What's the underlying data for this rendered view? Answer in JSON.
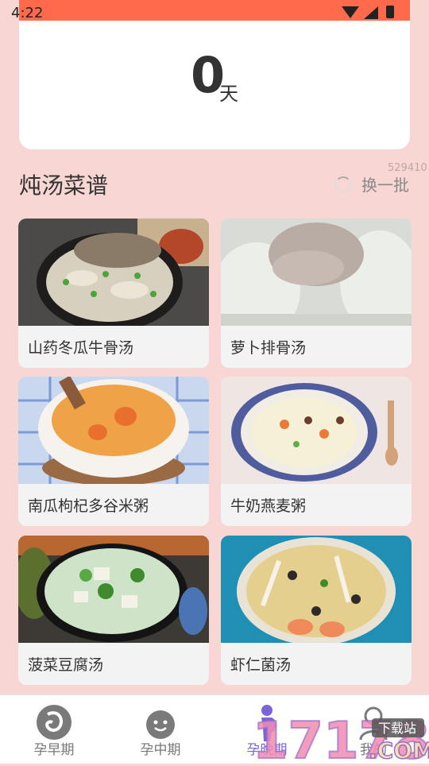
{
  "status_bar": {
    "time": "4:22"
  },
  "counter": {
    "value": "0",
    "unit": "天"
  },
  "section": {
    "title": "炖汤菜谱",
    "refresh_label": "换一批",
    "overlay_number": "529410"
  },
  "recipes": [
    {
      "name": "山药冬瓜牛骨汤"
    },
    {
      "name": "萝卜排骨汤"
    },
    {
      "name": "南瓜枸杞多谷米粥"
    },
    {
      "name": "牛奶燕麦粥"
    },
    {
      "name": "菠菜豆腐汤"
    },
    {
      "name": "虾仁菌汤"
    }
  ],
  "bottom_nav": {
    "items": [
      {
        "label": "孕早期",
        "icon": "fetus-icon"
      },
      {
        "label": "孕中期",
        "icon": "smiley-icon"
      },
      {
        "label": "孕晚期",
        "icon": "pregnant-woman-icon",
        "active": true
      },
      {
        "label": "我的",
        "icon": "profile-icon"
      }
    ]
  },
  "watermark": {
    "brand_text": "17178",
    "sub_text": "下载站",
    "domain_text": ".COM"
  },
  "colors": {
    "background": "#f8d6d3",
    "status_bar": "#ff6a4d",
    "accent": "#7b63d9"
  }
}
